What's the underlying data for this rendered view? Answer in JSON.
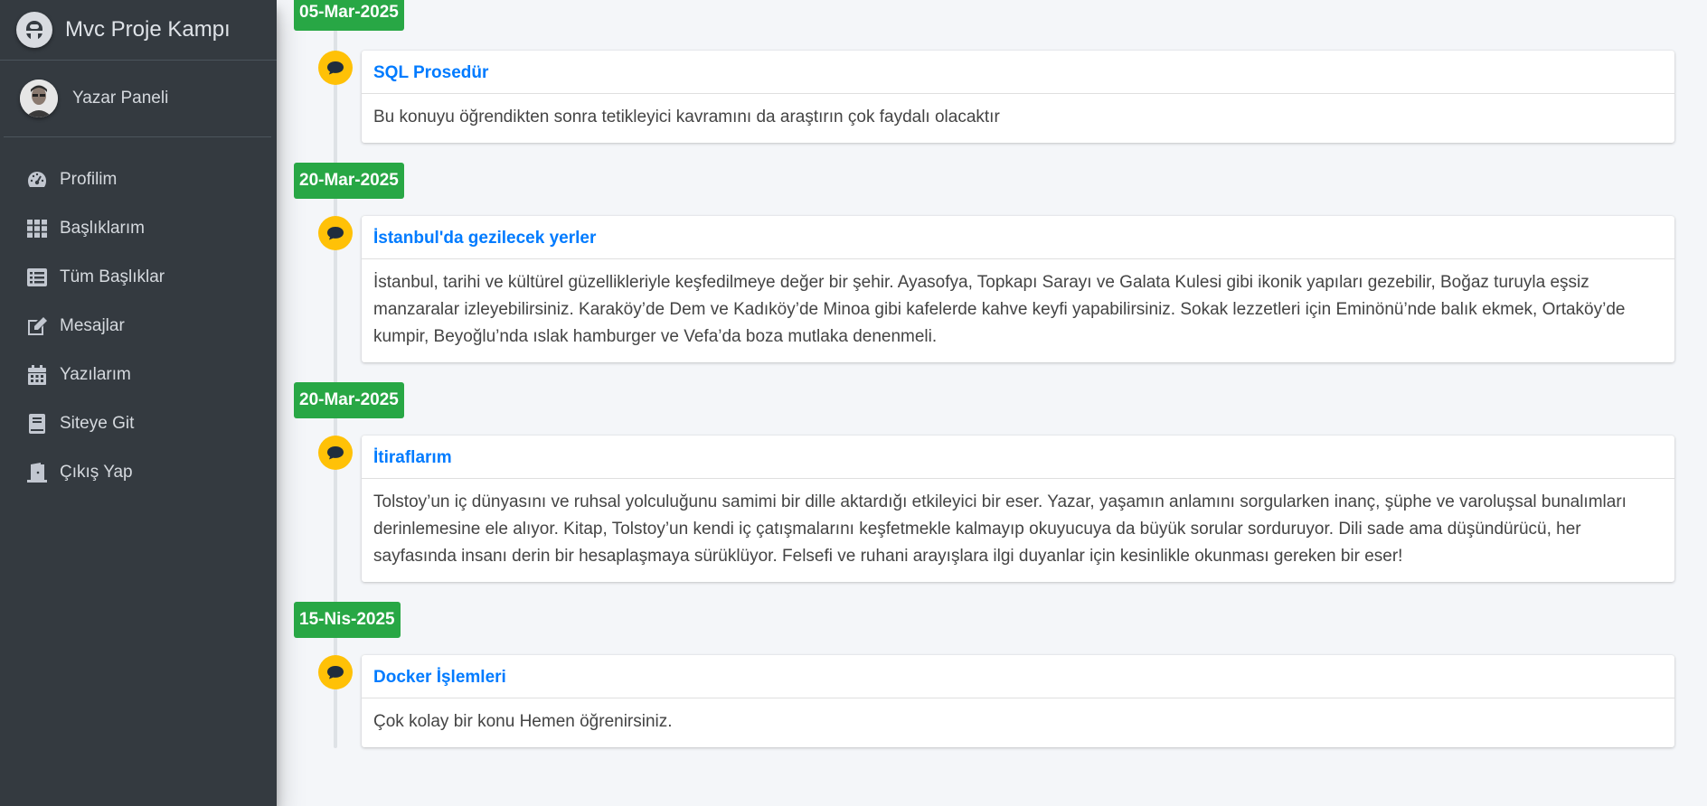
{
  "brand": {
    "title": "Mvc Proje Kampı"
  },
  "user": {
    "name": "Yazar Paneli"
  },
  "sidebar": {
    "items": [
      {
        "label": "Profilim",
        "icon": "tachometer-icon"
      },
      {
        "label": "Başlıklarım",
        "icon": "grid-icon"
      },
      {
        "label": "Tüm Başlıklar",
        "icon": "list-icon"
      },
      {
        "label": "Mesajlar",
        "icon": "edit-icon"
      },
      {
        "label": "Yazılarım",
        "icon": "calendar-icon"
      },
      {
        "label": "Siteye Git",
        "icon": "book-icon"
      },
      {
        "label": "Çıkış Yap",
        "icon": "door-icon"
      }
    ]
  },
  "timeline": [
    {
      "date": "05-Mar-2025",
      "title": "SQL Prosedür",
      "body": "Bu konuyu öğrendikten sonra tetikleyici kavramını da araştırın çok faydalı olacaktır"
    },
    {
      "date": "20-Mar-2025",
      "title": "İstanbul'da gezilecek yerler",
      "body": "İstanbul, tarihi ve kültürel güzellikleriyle keşfedilmeye değer bir şehir. Ayasofya, Topkapı Sarayı ve Galata Kulesi gibi ikonik yapıları gezebilir, Boğaz turuyla eşsiz manzaralar izleyebilirsiniz. Karaköy’de Dem ve Kadıköy’de Minoa gibi kafelerde kahve keyfi yapabilirsiniz. Sokak lezzetleri için Eminönü’nde balık ekmek, Ortaköy’de kumpir, Beyoğlu’nda ıslak hamburger ve Vefa’da boza mutlaka denenmeli."
    },
    {
      "date": "20-Mar-2025",
      "title": "İtiraflarım",
      "body": "Tolstoy’un iç dünyasını ve ruhsal yolculuğunu samimi bir dille aktardığı etkileyici bir eser. Yazar, yaşamın anlamını sorgularken inanç, şüphe ve varoluşsal bunalımları derinlemesine ele alıyor. Kitap, Tolstoy’un kendi iç çatışmalarını keşfetmekle kalmayıp okuyucuya da büyük sorular sorduruyor. Dili sade ama düşündürücü, her sayfasında insanı derin bir hesaplaşmaya sürüklüyor. Felsefi ve ruhani arayışlara ilgi duyanlar için kesinlikle okunması gereken bir eser!"
    },
    {
      "date": "15-Nis-2025",
      "title": "Docker İşlemleri",
      "body": "Çok kolay bir konu Hemen öğrenirsiniz."
    }
  ],
  "colors": {
    "sidebar_bg": "#343a40",
    "content_bg": "#f4f6f9",
    "date_badge": "#28a745",
    "timeline_icon": "#ffc107",
    "link": "#007bff"
  }
}
